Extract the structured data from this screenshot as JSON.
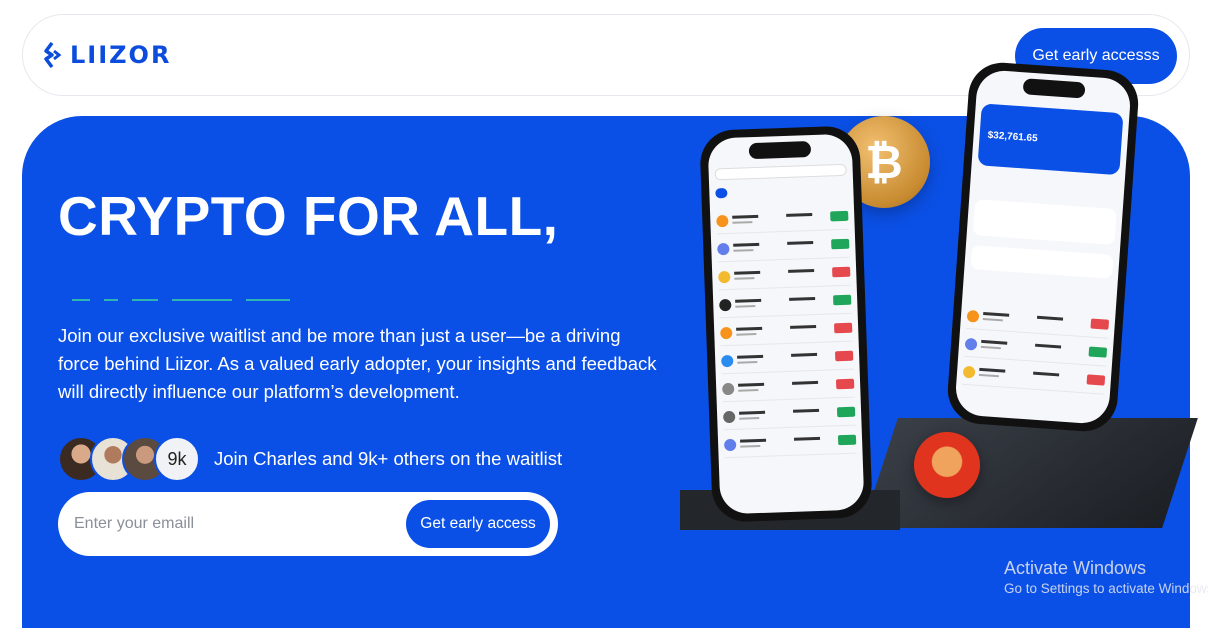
{
  "nav": {
    "logo_text": "LIIZOR",
    "cta_label": "Get early accesss"
  },
  "hero": {
    "headline": "CRYPTO FOR ALL,",
    "description": "Join our exclusive waitlist and be more than just a user—be a driving force behind Liizor. As a valued early adopter, your insights and feedback will directly influence our platform’s development.",
    "avatar_count": "9k",
    "waitlist_text": "Join Charles and 9k+ others on the waitlist",
    "email_placeholder": "Enter your emaill",
    "form_button_label": "Get early access"
  },
  "phones": {
    "balance": "$32,761.65",
    "coin_symbol": "₿"
  },
  "overlay": {
    "activate_title": "Activate Windows",
    "activate_subtitle": "Go to Settings to activate Windows."
  },
  "colors": {
    "brand_blue": "#0b50e6",
    "dash_teal": "#2fb6b0",
    "positive": "#1fa65a",
    "negative": "#e5484d"
  },
  "icons": [
    "logo-mark-icon",
    "bitcoin-coin-icon",
    "shiba-coin-icon"
  ]
}
